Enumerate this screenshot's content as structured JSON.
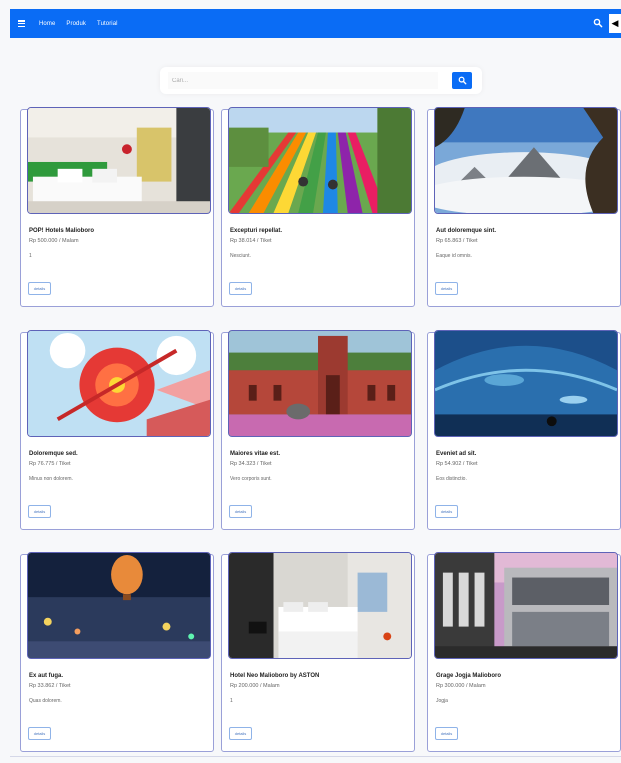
{
  "nav": {
    "links": [
      "Home",
      "Produk",
      "Tutorial"
    ],
    "user_glyph": "◀",
    "brand_color": "#0a6cf5"
  },
  "search": {
    "placeholder": "Cari...",
    "button_icon": "search-icon"
  },
  "cards": [
    {
      "title": "POP! Hotels Malioboro",
      "price": "Rp 500.000 / Malam",
      "desc": "1",
      "button_label": "details"
    },
    {
      "title": "Excepturi repellat.",
      "price": "Rp 38.014 / Tiket",
      "desc": "Nesciunt.",
      "button_label": "details"
    },
    {
      "title": "Aut doloremque sint.",
      "price": "Rp 65.863 / Tiket",
      "desc": "Eaque id omnis.",
      "button_label": "details"
    },
    {
      "title": "Doloremque sed.",
      "price": "Rp 76.775 / Tiket",
      "desc": "Minus non dolorem.",
      "button_label": "details"
    },
    {
      "title": "Maiores vitae est.",
      "price": "Rp 34.323 / Tiket",
      "desc": "Vero corporis sunt.",
      "button_label": "details"
    },
    {
      "title": "Eveniet ad sit.",
      "price": "Rp 54.902 / Tiket",
      "desc": "Eos distinctio.",
      "button_label": "details"
    },
    {
      "title": "Ex aut fuga.",
      "price": "Rp 33.862 / Tiket",
      "desc": "Quas dolorem.",
      "button_label": "details"
    },
    {
      "title": "Hotel Neo Malioboro by ASTON",
      "price": "Rp 200.000 / Malam",
      "desc": "1",
      "button_label": "details"
    },
    {
      "title": "Grage Jogja Malioboro",
      "price": "Rp 300.000 / Malam",
      "desc": "Jogja",
      "button_label": "details"
    }
  ]
}
